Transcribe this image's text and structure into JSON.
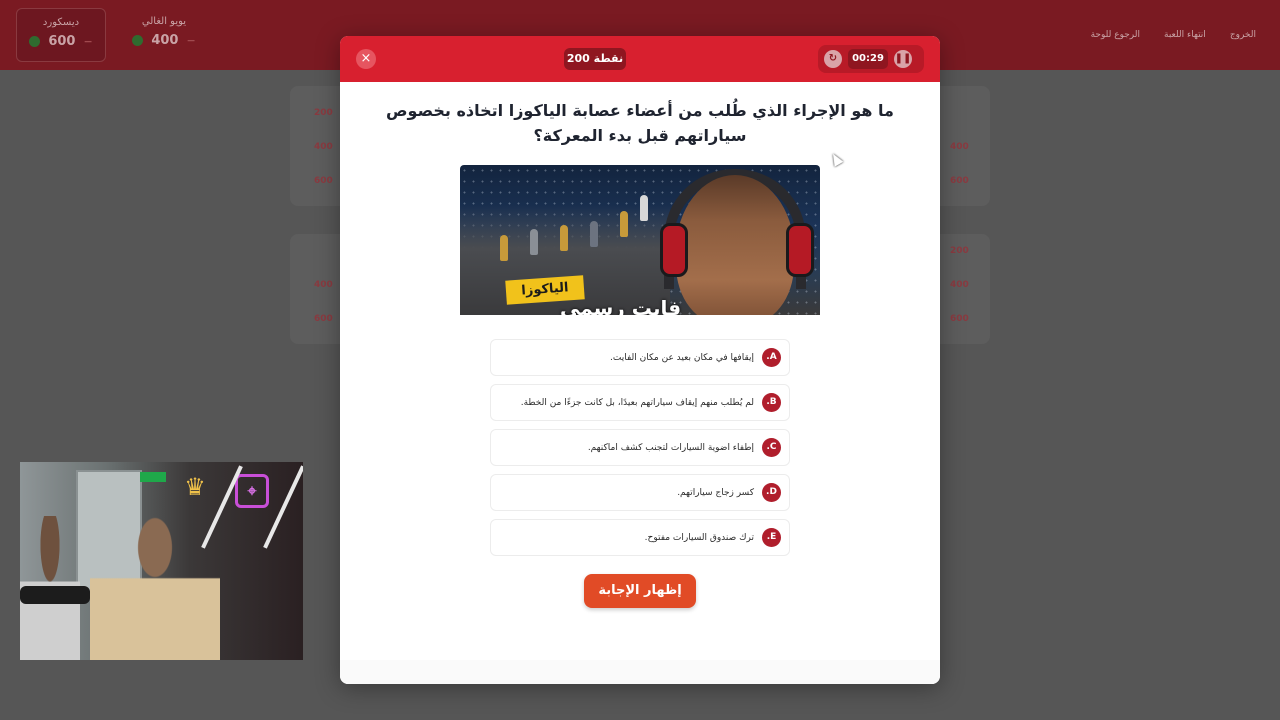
{
  "header": {
    "teams": [
      {
        "name": "ديسكورد",
        "score": "600",
        "active": true
      },
      {
        "name": "يويو الغالي",
        "score": "400",
        "active": false
      }
    ],
    "game_title": "",
    "nav": [
      "الخروج",
      "انتهاء اللعبة",
      "الرجوع للوحة"
    ]
  },
  "board": {
    "points": [
      "200",
      "400",
      "600"
    ]
  },
  "modal": {
    "points_label": "200 نقطة",
    "timer": "00:29",
    "close_symbol": "×",
    "reset_symbol": "↻",
    "pause_symbol": "❚❚",
    "question": "ما هو الإجراء الذي طُلب من أعضاء عصابة الياكوزا اتخاذه بخصوص سياراتهم قبل بدء المعركة؟",
    "image": {
      "tag_text": "الياكوزا",
      "caption_text": "فايت رسمي"
    },
    "options": [
      {
        "letter": "A.",
        "text": "إيقافها في مكان بعيد عن مكان الفايت."
      },
      {
        "letter": "B.",
        "text": "لم يُطلب منهم إيقاف سياراتهم بعيدًا، بل كانت جزءًا من الخطة."
      },
      {
        "letter": "C.",
        "text": "إطفاء اضوية السيارات لتجنب كشف اماكنهم."
      },
      {
        "letter": "D.",
        "text": "كسر زجاج سياراتهم."
      },
      {
        "letter": "E.",
        "text": "ترك صندوق السيارات مفتوح."
      }
    ],
    "reveal_button": "إظهار الإجابة"
  },
  "colors": {
    "accent_red": "#d8202f",
    "badge_red": "#b01e2c",
    "reveal_orange": "#e14b26"
  }
}
